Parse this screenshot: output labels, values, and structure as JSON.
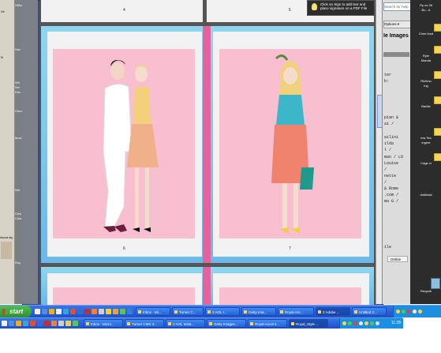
{
  "left_strip": {
    "labels": [
      "Office",
      "Nov",
      "Wh",
      "Ser",
      "Dec",
      "Chrom",
      "Mozi",
      "Net",
      "Cles",
      "Clea",
      "Roy",
      "Ascot sty"
    ]
  },
  "left_panel": {
    "labels": [
      "Xe",
      "N"
    ]
  },
  "pages": {
    "page4_label": "4",
    "page5_label": "5",
    "page6_label": "6",
    "page7_label": "7"
  },
  "tooltip": {
    "text": "Click on Sign to add text and place signature on a PDF File"
  },
  "right_panel": {
    "search_placeholder": "Search for help",
    "options_label": "Options ▾",
    "title": "le Images",
    "lines": [
      "ter",
      "b:",
      "pian &",
      "ai /",
      "ailini",
      "ilda",
      "l /",
      "man / LO",
      "Louise",
      "/",
      "nette",
      "/",
      "& Rome",
      ".com /",
      "ma G /"
    ],
    "bottom_label": "ile",
    "online_label": "Online"
  },
  "desktop_right": {
    "labels": [
      "Ry us 3tt",
      "Bo - A",
      "Chee food",
      "Ryte",
      "Manda",
      "Richmo",
      "Ing",
      "Barbie",
      "bra Tea",
      "ingent",
      "Cage cl",
      "dubblast",
      "Recycle"
    ]
  },
  "taskbar1": {
    "start_label": "start",
    "buttons": [
      "Inbox - Mi...",
      "Turner C...",
      "2 AOL I...",
      "Getty Ima...",
      "Royal Asc...",
      "2 Adobe ...",
      "Untitled 2..."
    ],
    "clock": "11:28"
  },
  "taskbar2": {
    "buttons": [
      "Inbox - Micro...",
      "Turner CMS 3...",
      "2 AOL Insta...",
      "Getty Images...",
      "Royal Ascot s...",
      "Royal_Style ..."
    ]
  },
  "colors": {
    "spread_blue": "#7cc8ee",
    "photo_pink": "#f7bfd0",
    "accent_pink": "#e5629e",
    "taskbar_blue": "#2663d8"
  }
}
